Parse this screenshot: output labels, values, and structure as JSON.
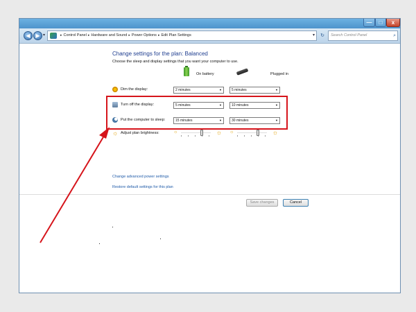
{
  "window": {
    "minimize_glyph": "—",
    "maximize_glyph": "□",
    "close_glyph": "x"
  },
  "address_bar": {
    "back_glyph": "◀",
    "forward_glyph": "▶",
    "dropdown_glyph": "▾",
    "breadcrumbs": [
      "Control Panel",
      "Hardware and Sound",
      "Power Options",
      "Edit Plan Settings"
    ],
    "separator": "▸",
    "refresh_glyph": "↻",
    "search_placeholder": "Search Control Panel",
    "search_glyph": "⌕"
  },
  "main": {
    "title": "Change settings for the plan: Balanced",
    "description": "Choose the sleep and display settings that you want your computer to use.",
    "columns": {
      "battery": "On battery",
      "plugged": "Plugged in"
    },
    "rows": [
      {
        "label": "Dim the display:",
        "battery": "2 minutes",
        "plugged": "5 minutes"
      },
      {
        "label": "Turn off the display:",
        "battery": "5 minutes",
        "plugged": "10 minutes"
      },
      {
        "label": "Put the computer to sleep:",
        "battery": "15 minutes",
        "plugged": "30 minutes"
      }
    ],
    "brightness": {
      "label": "Adjust plan brightness:",
      "battery_level": 0.7,
      "plugged_level": 0.7
    },
    "links": {
      "advanced": "Change advanced power settings",
      "restore": "Restore default settings for this plan"
    },
    "buttons": {
      "save": "Save changes",
      "cancel": "Cancel"
    },
    "dropdown_glyph": "▼",
    "sun_glyph": "☼"
  },
  "annotation": {
    "highlight_color": "#d6141b"
  }
}
